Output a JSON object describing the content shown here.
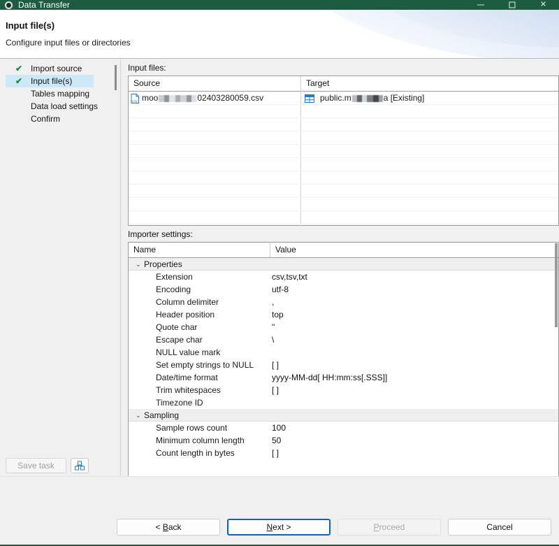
{
  "window": {
    "title": "Data Transfer",
    "icon": "app-logo-icon",
    "minimize_label": "–",
    "maximize_label": "□",
    "close_label": "✕",
    "titlebar_color": "#1d5c41"
  },
  "header": {
    "title": "Input file(s)",
    "subtitle": "Configure input files or directories"
  },
  "sidebar": {
    "items": [
      {
        "label": "Import source",
        "done": true,
        "selected": false,
        "check": "✔"
      },
      {
        "label": "Input file(s)",
        "done": true,
        "selected": true,
        "check": "✔"
      },
      {
        "label": "Tables mapping",
        "done": false,
        "selected": false,
        "check": ""
      },
      {
        "label": "Data load settings",
        "done": false,
        "selected": false,
        "check": ""
      },
      {
        "label": "Confirm",
        "done": false,
        "selected": false,
        "check": ""
      }
    ],
    "save_task_label": "Save task",
    "save_task_enabled": false,
    "save_icon_name": "save-task-icon",
    "check_color": "#1e8c3a",
    "selection_color": "#cde8f6"
  },
  "input_files": {
    "label": "Input files:",
    "columns": [
      "Source",
      "Target"
    ],
    "rows": [
      {
        "source_icon": "csv-file-icon",
        "source_prefix": "moo",
        "source_redacted": true,
        "source_suffix": "02403280059.csv",
        "target_icon": "database-table-icon",
        "target_prefix": "public.m",
        "target_redacted": true,
        "target_suffix": "a [Existing]"
      }
    ],
    "empty_row_count": 9
  },
  "importer_settings": {
    "label": "Importer settings:",
    "columns": [
      "Name",
      "Value"
    ],
    "groups": [
      {
        "name": "Properties",
        "expanded": true,
        "twisty": "⌄",
        "rows": [
          {
            "name": "Extension",
            "value": "csv,tsv,txt"
          },
          {
            "name": "Encoding",
            "value": "utf-8"
          },
          {
            "name": "Column delimiter",
            "value": ","
          },
          {
            "name": "Header position",
            "value": "top"
          },
          {
            "name": "Quote char",
            "value": "\""
          },
          {
            "name": "Escape char",
            "value": "\\"
          },
          {
            "name": "NULL value mark",
            "value": ""
          },
          {
            "name": "Set empty strings to NULL",
            "value": "[ ]"
          },
          {
            "name": "Date/time format",
            "value": "yyyy-MM-dd[ HH:mm:ss[.SSS]]"
          },
          {
            "name": "Trim whitespaces",
            "value": "[ ]"
          },
          {
            "name": "Timezone ID",
            "value": ""
          }
        ]
      },
      {
        "name": "Sampling",
        "expanded": true,
        "twisty": "⌄",
        "rows": [
          {
            "name": "Sample rows count",
            "value": "100"
          },
          {
            "name": "Minimum column length",
            "value": "50"
          },
          {
            "name": "Count length in bytes",
            "value": "[ ]"
          }
        ]
      }
    ]
  },
  "footer": {
    "buttons": [
      {
        "label": "< Back",
        "mnemonic": "B",
        "state": "normal",
        "name": "back-button"
      },
      {
        "label": "Next >",
        "mnemonic": "N",
        "state": "focused",
        "name": "next-button"
      },
      {
        "label": "Proceed",
        "mnemonic": "P",
        "state": "disabled",
        "name": "proceed-button"
      },
      {
        "label": "Cancel",
        "mnemonic": "",
        "state": "normal",
        "name": "cancel-button"
      }
    ],
    "focus_color": "#0a65b8"
  }
}
